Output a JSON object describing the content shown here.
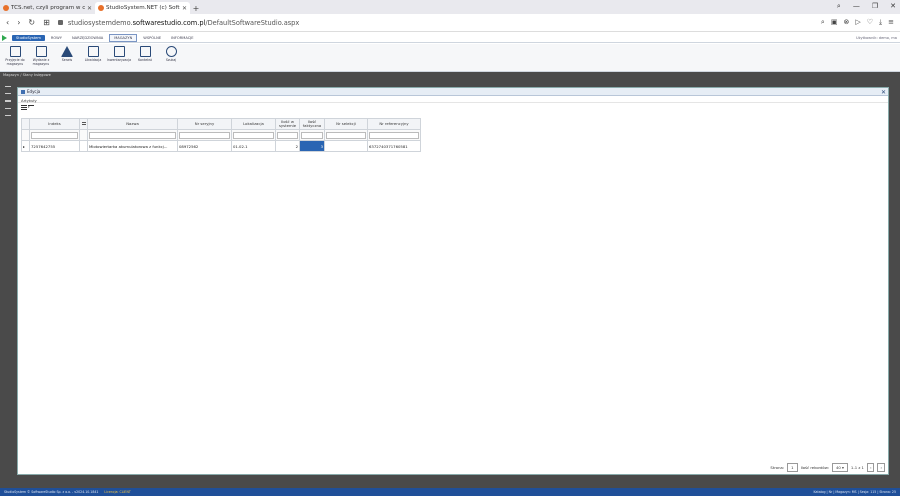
{
  "browser": {
    "tabs": [
      {
        "title": "TCS.net, czyli program w c..."
      },
      {
        "title": "StudioSystem.NET (c) Soft..."
      }
    ],
    "address": {
      "prefix": "studiosystemdemo.",
      "host": "softwarestudio.com.pl",
      "path": "/DefaultSoftwareStudio.aspx"
    }
  },
  "app": {
    "ribbon_tabs": [
      "StudioSystem",
      "ROWY",
      "NARZĘDZIOWNIA",
      "MAGAZYN",
      "WSPÓLNE",
      "INFORMACJE"
    ],
    "active_tab": "MAGAZYN",
    "user_info": "Użytkownik: demo, ma",
    "ribbon_buttons": [
      {
        "label": "Przyjęcie do magazynu",
        "icon": "document-icon"
      },
      {
        "label": "Wydanie z magazynu",
        "icon": "document-icon"
      },
      {
        "label": "Serwis",
        "icon": "warning-icon"
      },
      {
        "label": "Likwidacja",
        "icon": "delete-document-icon"
      },
      {
        "label": "Inwentaryzacja",
        "icon": "edit-icon"
      },
      {
        "label": "Kontekst",
        "icon": "inbox-icon"
      },
      {
        "label": "Szukaj",
        "icon": "search-icon"
      }
    ],
    "breadcrumb": "Magazyn / Stany księgowe"
  },
  "modal": {
    "title": "Edycja",
    "section": "Artykuły",
    "columns": [
      "Indeks",
      "",
      "Nazwa",
      "Nr seryjny",
      "Lokalizacja",
      "Ilość w systemie",
      "Ilość faktyczna",
      "Nr selekcji",
      "Nr referencyjny"
    ],
    "rows": [
      {
        "index": "7257642755",
        "name": "Mlotowiertarka akumulatorowa z funkcj...",
        "serial": "08972562",
        "location": "01.02.1",
        "qty_system": "2",
        "qty_actual": "3",
        "selection": "",
        "reference": "6372740371760581"
      }
    ],
    "pager": {
      "page_label": "Strona:",
      "page": "1",
      "per_page_label": "Ilość rekordów:",
      "per_page": "40",
      "range": "1-1 z 1"
    }
  },
  "statusbar": {
    "left": "StudioSystem © SoftwareStudio Sp. z o.o. - v2024.10.1841",
    "warn": "Licencja: CLIENT",
    "right": "Katalog | Nr | Magazyn: MS | Sesja: 115 | Strona: 25"
  }
}
